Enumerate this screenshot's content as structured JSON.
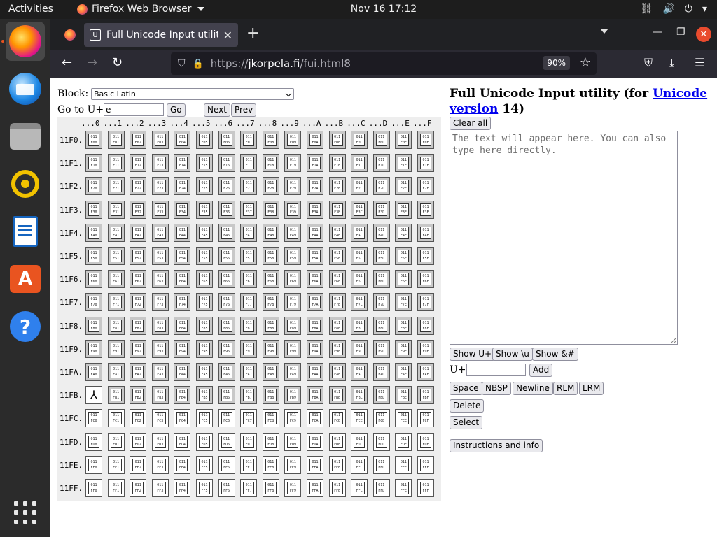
{
  "topbar": {
    "activities": "Activities",
    "app_name": "Firefox Web Browser",
    "clock": "Nov 16  17:12"
  },
  "dock": {
    "items": [
      "firefox-icon",
      "thunderbird-icon",
      "files-icon",
      "rhythmbox-icon",
      "writer-icon",
      "software-icon",
      "help-icon",
      "app-grid-icon"
    ]
  },
  "browser": {
    "tab_title": "Full Unicode Input utility",
    "url_prefix": "https://",
    "url_host": "jkorpela.fi",
    "url_suffix": "/fui.html8",
    "zoom": "90%"
  },
  "page": {
    "block_label": "Block:",
    "block_value": "Basic Latin",
    "goto_label": "Go to U+",
    "goto_value": "e",
    "go_btn": "Go",
    "next_btn": "Next",
    "prev_btn": "Prev",
    "title_text1": "Full Unicode Input utility (for ",
    "title_link1": "Unicode",
    "title_link2": "version",
    "title_text2": " 14)",
    "clear_all": "Clear all",
    "textarea_placeholder": "The text will appear here. You can also type here directly.",
    "show_uplus": "Show U+",
    "show_u": "Show \\u",
    "show_amp": "Show &#",
    "uplus_label": "U+",
    "add_btn": "Add",
    "space_btn": "Space",
    "nbsp_btn": "NBSP",
    "newline_btn": "Newline",
    "rlm_btn": "RLM",
    "lrm_btn": "LRM",
    "delete_btn": "Delete",
    "select_btn": "Select",
    "instructions_btn": "Instructions and info"
  },
  "grid": {
    "columns": [
      "...0",
      "...1",
      "...2",
      "...3",
      "...4",
      "...5",
      "...6",
      "...7",
      "...8",
      "...9",
      "...A",
      "...B",
      "...C",
      "...D",
      "...E",
      "...F"
    ],
    "rows": [
      "11F0.",
      "11F1.",
      "11F2.",
      "11F3.",
      "11F4.",
      "11F5.",
      "11F6.",
      "11F7.",
      "11F8.",
      "11F9.",
      "11FA.",
      "11FB.",
      "11FC.",
      "11FD.",
      "11FE.",
      "11FF."
    ],
    "row_prefixes": [
      "F0",
      "F1",
      "F2",
      "F3",
      "F4",
      "F5",
      "F6",
      "F7",
      "F8",
      "F9",
      "FA",
      "FB",
      "FC",
      "FD",
      "FE",
      "FF"
    ],
    "special_glyph": "⅄",
    "special_row": 11,
    "special_col": 0,
    "light_rows_from": 12
  }
}
